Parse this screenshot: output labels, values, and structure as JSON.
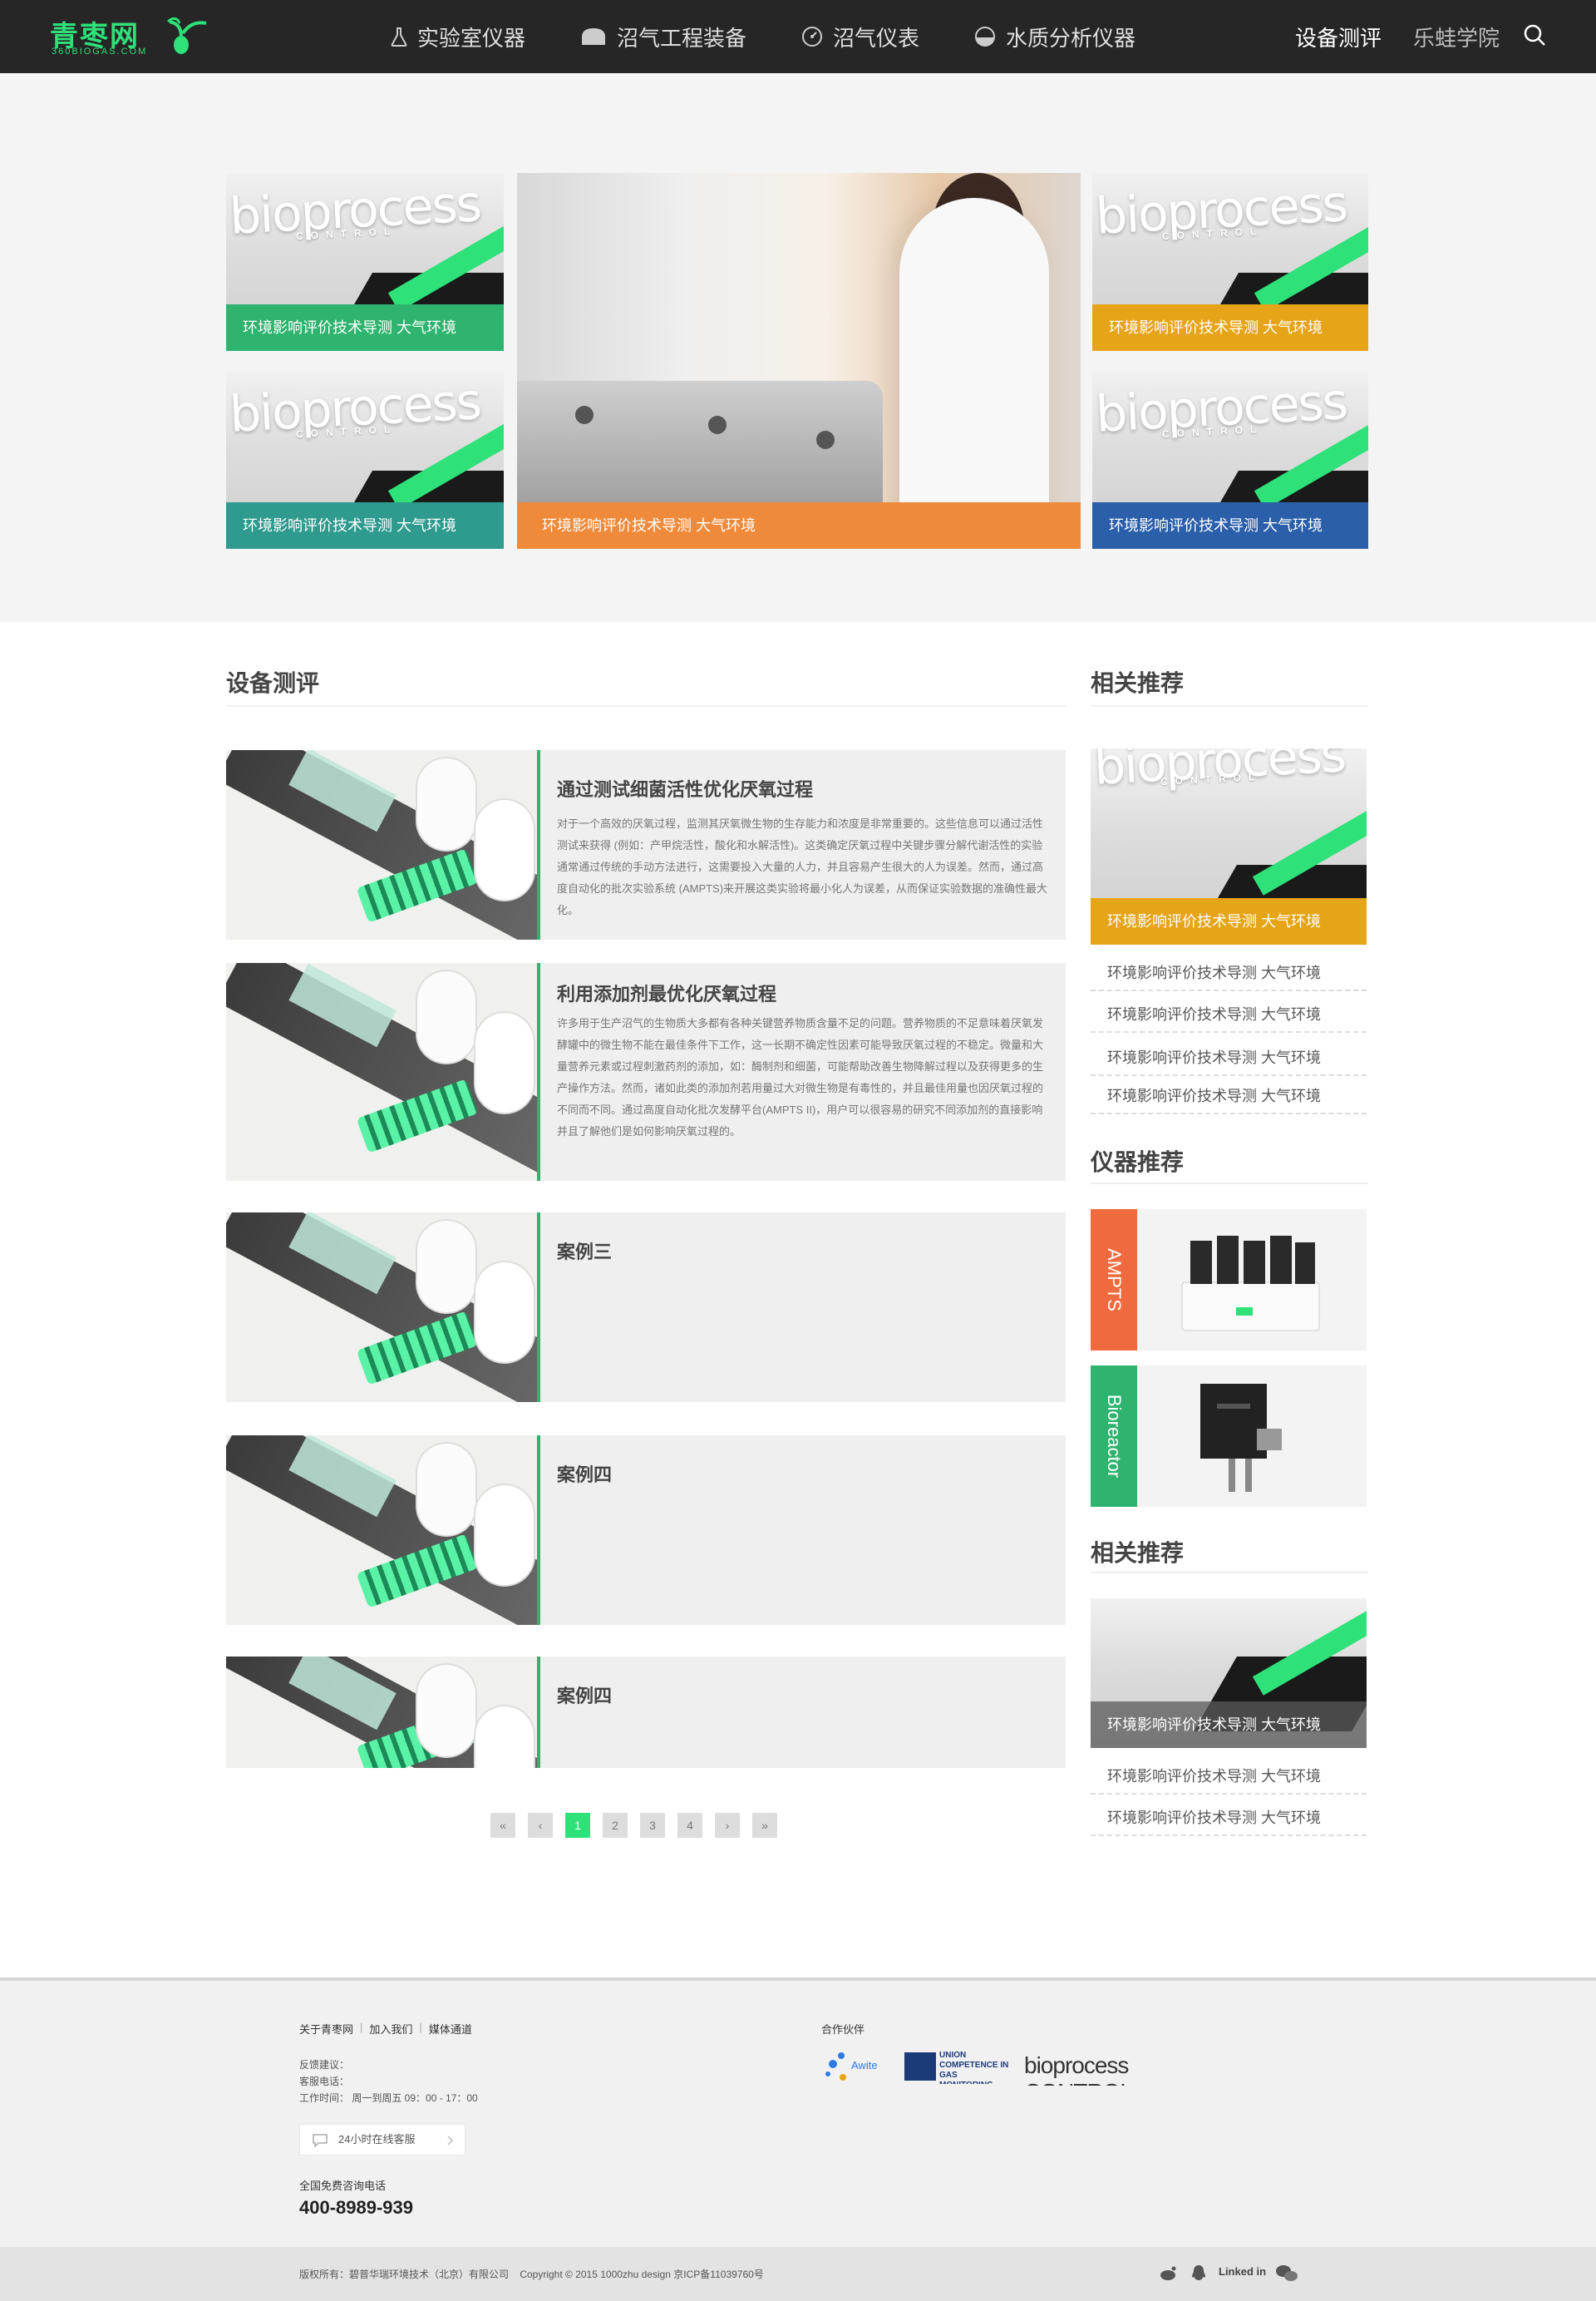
{
  "logo": {
    "name": "青枣网",
    "domain": "360BIOGAS.COM"
  },
  "nav": {
    "items": [
      {
        "label": "实验室仪器",
        "icon": "flask-icon"
      },
      {
        "label": "沼气工程装备",
        "icon": "tank-icon"
      },
      {
        "label": "沼气仪表",
        "icon": "gauge-icon"
      },
      {
        "label": "水质分析仪器",
        "icon": "water-drop-icon"
      }
    ],
    "right": [
      {
        "label": "设备测评"
      },
      {
        "label": "乐蛙学院"
      }
    ],
    "search_icon": "search-icon"
  },
  "hero": {
    "brand": "bioprocess",
    "brand_sub": "CONTROL",
    "captions": [
      "环境影响评价技术导测 大气环境",
      "环境影响评价技术导测 大气环境",
      "环境影响评价技术导测 大气环境",
      "环境影响评价技术导测 大气环境",
      "环境影响评价技术导测 大气环境"
    ],
    "colors": [
      "#2eb46e",
      "#2f9a8e",
      "#ef8a3a",
      "#e6a419",
      "#2c5fa9"
    ]
  },
  "main": {
    "title": "设备测评",
    "articles": [
      {
        "title": "通过测试细菌活性优化厌氧过程",
        "body": "对于一个高效的厌氧过程，监测其厌氧微生物的生存能力和浓度是非常重要的。这些信息可以通过活性测试来获得 (例如：产甲烷活性，酸化和水解活性)。这类确定厌氧过程中关键步骤分解代谢活性的实验通常通过传统的手动方法进行，这需要投入大量的人力，并且容易产生很大的人为误差。然而，通过高度自动化的批次实验系统 (AMPTS)来开展这类实验将最小化人为误差，从而保证实验数据的准确性最大化。"
      },
      {
        "title": "利用添加剂最优化厌氧过程",
        "body": "许多用于生产沼气的生物质大多都有各种关键营养物质含量不足的问题。营养物质的不足意味着厌氧发酵罐中的微生物不能在最佳条件下工作，这一长期不确定性因素可能导致厌氧过程的不稳定。微量和大量营养元素或过程刺激药剂的添加，如：酶制剂和细菌，可能帮助改善生物降解过程以及获得更多的生产操作方法。然而，诸如此类的添加剂若用量过大对微生物是有毒性的，并且最佳用量也因厌氧过程的不同而不同。通过高度自动化批次发酵平台(AMPTS II)，用户可以很容易的研究不同添加剂的直接影响并且了解他们是如何影响厌氧过程的。"
      },
      {
        "title": "案例三",
        "body": ""
      },
      {
        "title": "案例四",
        "body": ""
      },
      {
        "title": "案例四",
        "body": ""
      }
    ],
    "pager": [
      "«",
      "‹",
      "1",
      "2",
      "3",
      "4",
      "›",
      "»"
    ]
  },
  "sidebar": {
    "related_title": "相关推荐",
    "related_card": "环境影响评价技术导测 大气环境",
    "related_links": [
      "环境影响评价技术导测 大气环境",
      "环境影响评价技术导测 大气环境",
      "环境影响评价技术导测 大气环境",
      "环境影响评价技术导测 大气环境"
    ],
    "instruments_title": "仪器推荐",
    "instruments": [
      {
        "tag": "AMPTS",
        "color": "#ef6a3e"
      },
      {
        "tag": "Bioreactor",
        "color": "#2eb46e"
      }
    ],
    "related2_title": "相关推荐",
    "related2_card": "环境影响评价技术导测 大气环境",
    "related2_links": [
      "环境影响评价技术导测 大气环境",
      "环境影响评价技术导测 大气环境"
    ]
  },
  "footer": {
    "links": [
      "关于青枣网",
      "加入我们",
      "媒体通道"
    ],
    "feedback": "反馈建议：",
    "service_phone": "客服电话：",
    "hours": "工作时间： 周一到周五 09：00 - 17：00",
    "chat": "24小时在线客服",
    "hotline_label": "全国免费咨询电话",
    "hotline": "400-8989-939",
    "partners_title": "合作伙伴",
    "partners": [
      "Awite",
      "UNION COMPETENCE IN GAS MONITORING",
      "bioprocess CONTROL"
    ],
    "copyright": "版权所有：碧普华瑞环境技术（北京）有限公司    Copyright © 2015 1000zhu design 京ICP备11039760号",
    "social": [
      "weibo-icon",
      "qq-icon",
      "Linked in",
      "wechat-icon"
    ]
  }
}
